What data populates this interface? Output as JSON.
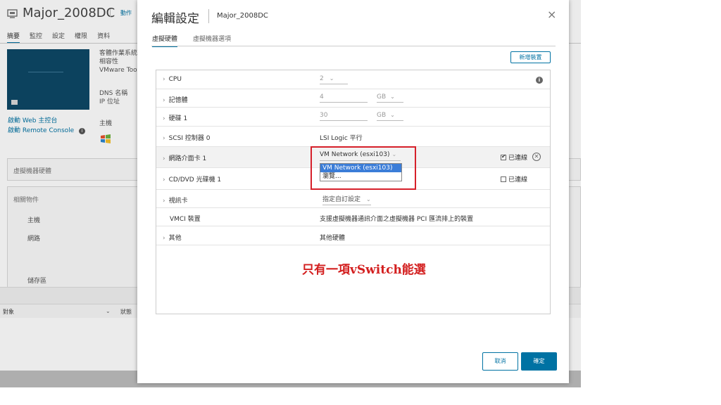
{
  "background": {
    "vm_name": "Major_2008DC",
    "actions_label": "動作",
    "tabs": [
      "摘要",
      "監控",
      "設定",
      "權限",
      "資料"
    ],
    "info_lines": [
      "客體作業系統",
      "相容性",
      "VMware Too"
    ],
    "dns_label": "DNS 名稱",
    "ip_label": "IP 位址",
    "host_label": "主機",
    "web_console_link": "啟動 Web 主控台",
    "remote_console_link": "啟動 Remote Console",
    "vm_hardware_section": "虛擬機器硬體",
    "related_objects_section": "相關物件",
    "related_items": [
      "主機",
      "網路",
      "儲存區"
    ],
    "bottom_header_object": "對象",
    "bottom_header_status": "狀態"
  },
  "dialog": {
    "title": "編輯設定",
    "vm_name": "Major_2008DC",
    "close_glyph": "×",
    "tabs": [
      "虛擬硬體",
      "虛擬機器選項"
    ],
    "add_device_button": "新增裝置",
    "rows": {
      "cpu": {
        "label": "CPU",
        "value": "2"
      },
      "memory": {
        "label": "記憶體",
        "value": "4",
        "unit": "GB"
      },
      "disk": {
        "label": "硬碟 1",
        "value": "30",
        "unit": "GB"
      },
      "scsi": {
        "label": "SCSI 控制器 0",
        "value": "LSI Logic 平行"
      },
      "nic": {
        "label": "網路介面卡 1",
        "selected": "VM Network (esxi103)",
        "options": [
          "VM Network (esxi103)",
          "瀏覽..."
        ],
        "connected_label": "已連線",
        "connected": true
      },
      "cdrom": {
        "label": "CD/DVD 光碟機 1",
        "connected_label": "已連線",
        "connected": false
      },
      "video": {
        "label": "視訊卡",
        "value": "指定自訂設定"
      },
      "vmci": {
        "label": "VMCI 裝置",
        "value": "支援虛擬機器通訊介面之虛擬機器 PCI 匯流排上的裝置"
      },
      "other": {
        "label": "其他",
        "value": "其他硬體"
      }
    },
    "annotation": "只有一項vSwitch能選",
    "cancel_button": "取消",
    "ok_button": "確定"
  },
  "icons": {
    "chevron_right": "›",
    "dropdown": "⌄",
    "info": "i",
    "remove": "⊗"
  },
  "colors": {
    "accent": "#0072a3",
    "highlight_box": "#d6202a",
    "annotation": "#d31f1f",
    "selected_option": "#3b7dd8"
  }
}
